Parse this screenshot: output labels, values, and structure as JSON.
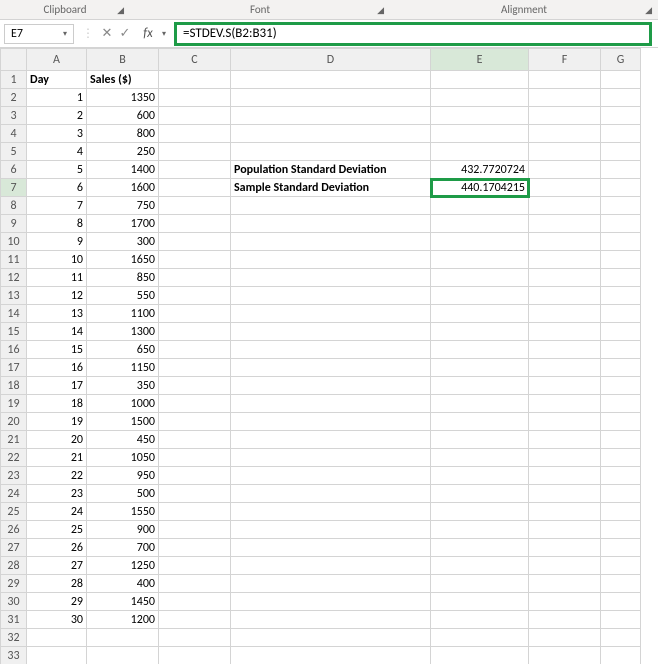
{
  "ribbon_groups": [
    "Clipboard",
    "Font",
    "Alignment"
  ],
  "name_box": "E7",
  "formula": "=STDEV.S(B2:B31)",
  "columns": [
    "A",
    "B",
    "C",
    "D",
    "E",
    "F",
    "G"
  ],
  "headers": {
    "A": "Day",
    "B": "Sales ($)"
  },
  "labels": {
    "D6": "Population Standard Deviation",
    "D7": "Sample Standard Deviation"
  },
  "results": {
    "E6": "432.7720724",
    "E7": "440.1704215"
  },
  "data_rows": [
    {
      "day": 1,
      "sales": 1350
    },
    {
      "day": 2,
      "sales": 600
    },
    {
      "day": 3,
      "sales": 800
    },
    {
      "day": 4,
      "sales": 250
    },
    {
      "day": 5,
      "sales": 1400
    },
    {
      "day": 6,
      "sales": 1600
    },
    {
      "day": 7,
      "sales": 750
    },
    {
      "day": 8,
      "sales": 1700
    },
    {
      "day": 9,
      "sales": 300
    },
    {
      "day": 10,
      "sales": 1650
    },
    {
      "day": 11,
      "sales": 850
    },
    {
      "day": 12,
      "sales": 550
    },
    {
      "day": 13,
      "sales": 1100
    },
    {
      "day": 14,
      "sales": 1300
    },
    {
      "day": 15,
      "sales": 650
    },
    {
      "day": 16,
      "sales": 1150
    },
    {
      "day": 17,
      "sales": 350
    },
    {
      "day": 18,
      "sales": 1000
    },
    {
      "day": 19,
      "sales": 1500
    },
    {
      "day": 20,
      "sales": 450
    },
    {
      "day": 21,
      "sales": 1050
    },
    {
      "day": 22,
      "sales": 950
    },
    {
      "day": 23,
      "sales": 500
    },
    {
      "day": 24,
      "sales": 1550
    },
    {
      "day": 25,
      "sales": 900
    },
    {
      "day": 26,
      "sales": 700
    },
    {
      "day": 27,
      "sales": 1250
    },
    {
      "day": 28,
      "sales": 400
    },
    {
      "day": 29,
      "sales": 1450
    },
    {
      "day": 30,
      "sales": 1200
    }
  ],
  "total_rows": 33,
  "active_cell": "E7"
}
